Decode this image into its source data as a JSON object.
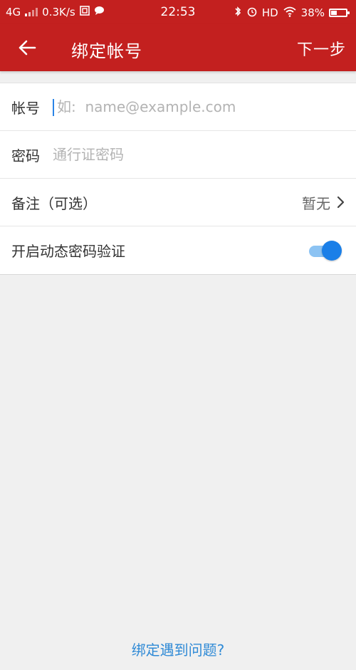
{
  "status_bar": {
    "network": "4G",
    "speed": "0.3K/s",
    "time": "22:53",
    "hd": "HD",
    "battery": "38%",
    "battery_level": 38
  },
  "app_bar": {
    "title": "绑定帐号",
    "next": "下一步"
  },
  "form": {
    "account": {
      "label": "帐号",
      "placeholder": "如:  name@example.com",
      "value": ""
    },
    "password": {
      "label": "密码",
      "placeholder": "通行证密码",
      "value": ""
    },
    "note": {
      "label": "备注（可选）",
      "value": "暂无"
    },
    "otp": {
      "label": "开启动态密码验证",
      "enabled": true
    }
  },
  "footer": {
    "help": "绑定遇到问题?"
  },
  "colors": {
    "brand": "#c3201f",
    "accent": "#1a7fe8",
    "link": "#2f8ad6"
  }
}
